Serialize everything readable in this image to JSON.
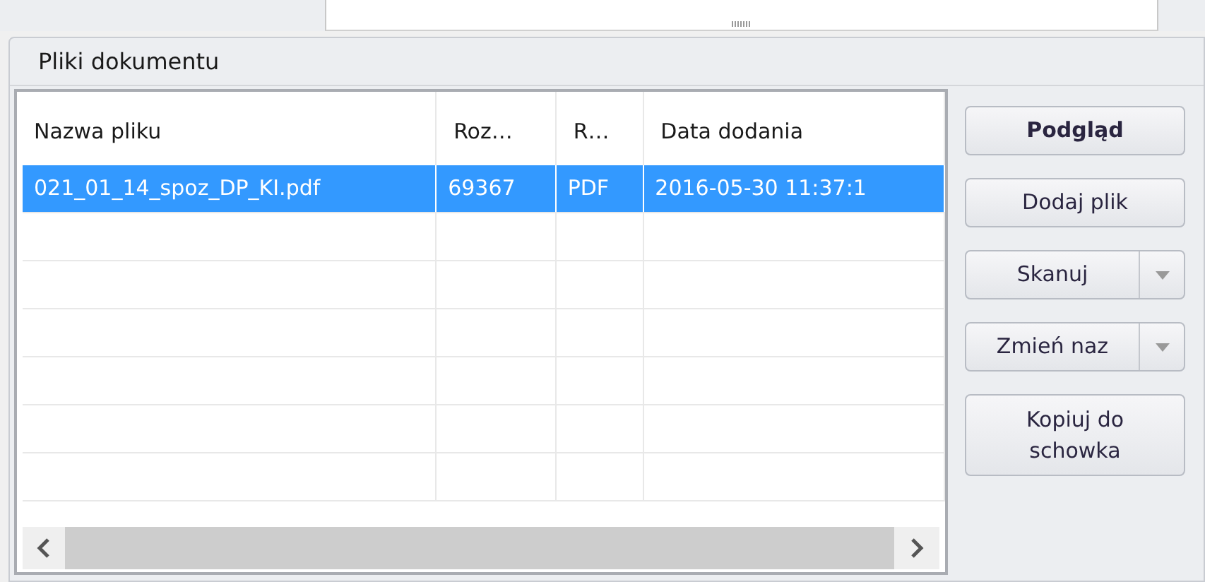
{
  "group_title": "Pliki dokumentu",
  "table": {
    "columns": [
      "Nazwa pliku",
      "Roz…",
      "R…",
      "Data dodania"
    ],
    "rows": [
      {
        "cells": [
          "021_01_14_spoz_DP_KI.pdf",
          "69367",
          "PDF",
          "2016-05-30 11:37:1"
        ],
        "selected": true
      }
    ]
  },
  "buttons": [
    {
      "label": "Podgląd",
      "kind": "default"
    },
    {
      "label": "Dodaj plik",
      "kind": "plain"
    },
    {
      "label": "Skanuj",
      "kind": "split"
    },
    {
      "label": "Zmień naz",
      "kind": "split"
    },
    {
      "label": "Kopiuj do schowka",
      "kind": "plain"
    }
  ]
}
